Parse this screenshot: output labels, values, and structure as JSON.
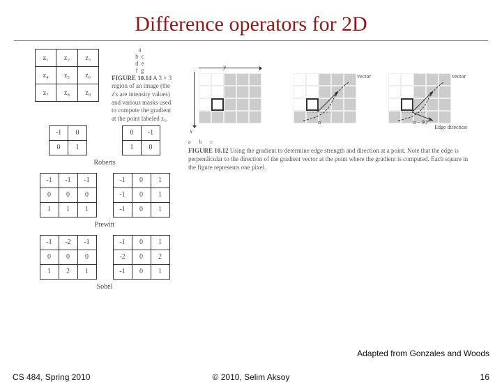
{
  "title": "Difference operators for 2D",
  "z_matrix": {
    "rows": [
      [
        "z₁",
        "z₂",
        "z₃"
      ],
      [
        "z₄",
        "z₅",
        "z₆"
      ],
      [
        "z₇",
        "z₈",
        "z₉"
      ]
    ]
  },
  "fig1014": {
    "abc_labels": [
      "a",
      "b c",
      "d e",
      "f g"
    ],
    "number": "FIGURE 10.14",
    "text": "A 3 × 3 region of an image (the z's are intensity values) and various masks used to compute the gradient at the point labeled z₅."
  },
  "roberts": {
    "label": "Roberts",
    "left": [
      [
        "-1",
        "0"
      ],
      [
        "0",
        "1"
      ]
    ],
    "right": [
      [
        "0",
        "-1"
      ],
      [
        "1",
        "0"
      ]
    ]
  },
  "prewitt": {
    "label": "Prewitt",
    "left": [
      [
        "-1",
        "-1",
        "-1"
      ],
      [
        "0",
        "0",
        "0"
      ],
      [
        "1",
        "1",
        "1"
      ]
    ],
    "right": [
      [
        "-1",
        "0",
        "1"
      ],
      [
        "-1",
        "0",
        "1"
      ],
      [
        "-1",
        "0",
        "1"
      ]
    ]
  },
  "sobel": {
    "label": "Sobel",
    "left": [
      [
        "-1",
        "-2",
        "-1"
      ],
      [
        "0",
        "0",
        "0"
      ],
      [
        "1",
        "2",
        "1"
      ]
    ],
    "right": [
      [
        "-1",
        "0",
        "1"
      ],
      [
        "-2",
        "0",
        "2"
      ],
      [
        "-1",
        "0",
        "1"
      ]
    ]
  },
  "gradient": {
    "y_axis": "y",
    "x_axis": "x",
    "gv_label": "Gradient vector",
    "edge_label": "Edge direction",
    "alpha_label": "α",
    "alpha90_label": "α − 90°"
  },
  "fig1012": {
    "abc": "a b c",
    "number": "FIGURE 10.12",
    "text": "Using the gradient to determine edge strength and direction at a point. Note that the edge is perpendicular to the direction of the gradient vector at the point where the gradient is computed. Each square in the figure represents one pixel."
  },
  "adapted": "Adapted from Gonzales and Woods",
  "footer": {
    "left": "CS 484, Spring 2010",
    "center": "© 2010, Selim Aksoy",
    "right": "16"
  }
}
